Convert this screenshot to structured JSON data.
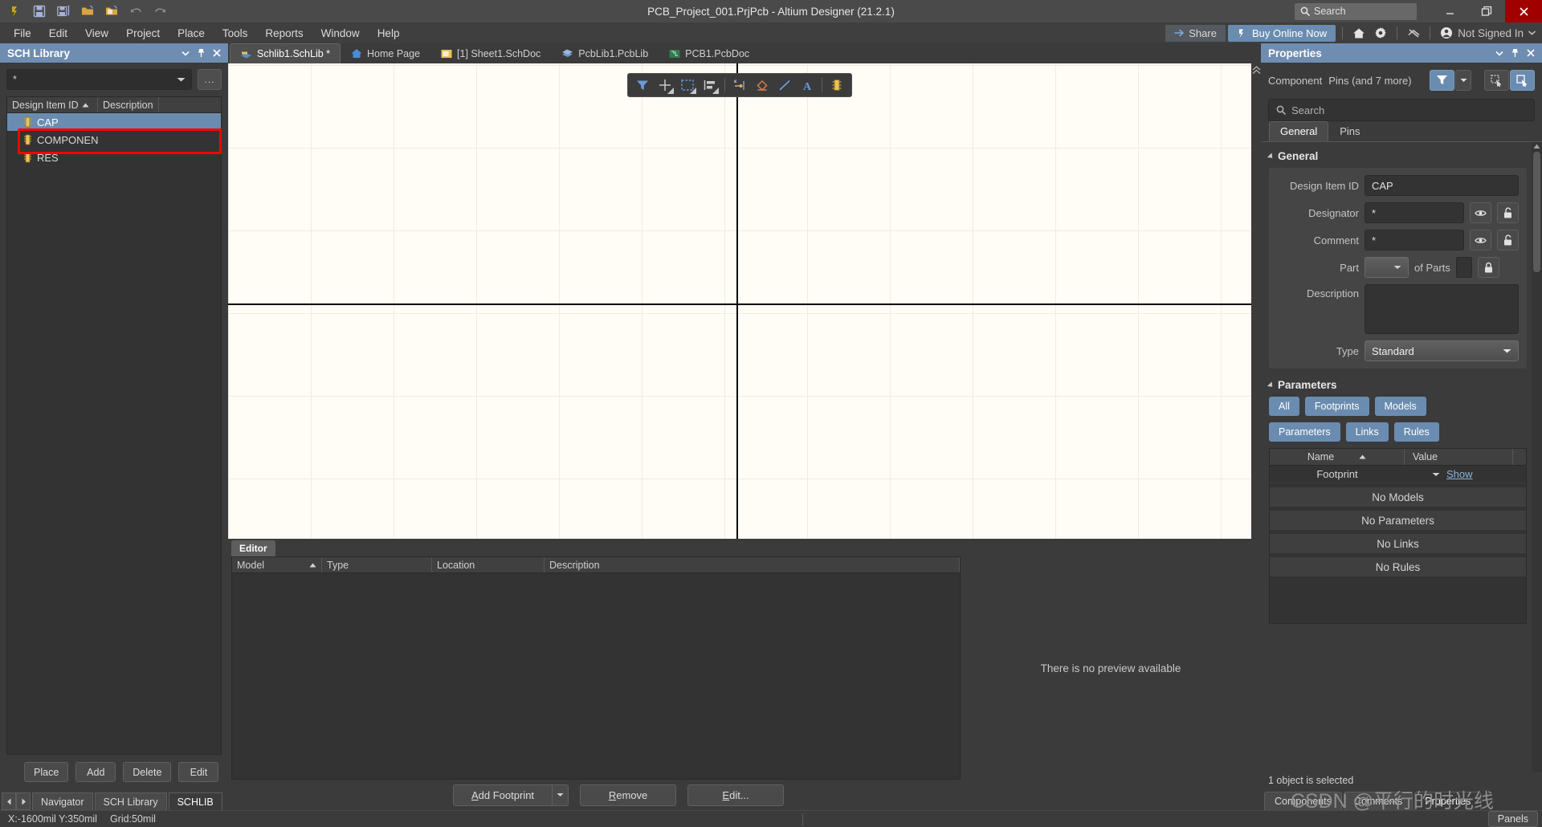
{
  "titlebar": {
    "title": "PCB_Project_001.PrjPcb - Altium Designer (21.2.1)",
    "search_placeholder": "Search",
    "quick_access": [
      {
        "name": "altium-logo-icon",
        "label": "Altium"
      },
      {
        "name": "save-icon",
        "label": "Save"
      },
      {
        "name": "save-all-icon",
        "label": "Save All"
      },
      {
        "name": "open-icon",
        "label": "Open"
      },
      {
        "name": "open-project-icon",
        "label": "Open Project"
      },
      {
        "name": "undo-icon",
        "label": "Undo"
      },
      {
        "name": "redo-icon",
        "label": "Redo"
      }
    ],
    "minimize": "–",
    "maximize": "❐",
    "close": "✕"
  },
  "menubar": {
    "items": [
      "File",
      "Edit",
      "View",
      "Project",
      "Place",
      "Tools",
      "Reports",
      "Window",
      "Help"
    ],
    "share_label": "Share",
    "buy_label": "Buy Online Now",
    "signin_label": "Not Signed In",
    "icons": [
      "home-icon",
      "settings-gear-icon",
      "notifications-icon"
    ]
  },
  "left_panel": {
    "title": "SCH Library",
    "filter_value": "*",
    "dots_label": "...",
    "columns": [
      {
        "label": "Design Item ID",
        "sorted": true
      },
      {
        "label": "Description",
        "sorted": false
      }
    ],
    "items": [
      {
        "label": "CAP",
        "selected": true
      },
      {
        "label": "COMPONEN",
        "selected": false
      },
      {
        "label": "RES",
        "selected": false
      }
    ],
    "buttons": [
      "Place",
      "Add",
      "Delete",
      "Edit"
    ],
    "tabs": [
      {
        "label": "Navigator",
        "active": false
      },
      {
        "label": "SCH Library",
        "active": false
      },
      {
        "label": "SCHLIB",
        "active": true
      }
    ]
  },
  "doc_tabs": [
    {
      "label": "Schlib1.SchLib *",
      "icon": "schlib-icon",
      "active": true
    },
    {
      "label": "Home Page",
      "icon": "home-icon",
      "active": false
    },
    {
      "label": "[1] Sheet1.SchDoc",
      "icon": "schdoc-icon",
      "active": false
    },
    {
      "label": "PcbLib1.PcbLib",
      "icon": "pcblib-icon",
      "active": false
    },
    {
      "label": "PCB1.PcbDoc",
      "icon": "pcbdoc-icon",
      "active": false
    }
  ],
  "float_toolbar": {
    "tools": [
      {
        "name": "filter-icon",
        "caret": false
      },
      {
        "name": "crosshair-icon",
        "caret": true
      },
      {
        "name": "selection-rect-icon",
        "caret": true
      },
      {
        "name": "align-icon",
        "caret": true
      },
      {
        "name": "place-pin-icon",
        "caret": false
      },
      {
        "name": "place-polygon-icon",
        "caret": false
      },
      {
        "name": "place-line-icon",
        "caret": false
      },
      {
        "name": "place-text-icon",
        "caret": false
      },
      {
        "name": "place-component-icon",
        "caret": false
      }
    ]
  },
  "model_panel": {
    "editor_tab": "Editor",
    "columns": [
      "Model",
      "Type",
      "Location",
      "Description"
    ],
    "preview_text": "There is no preview available",
    "buttons": {
      "add_footprint": "Add Footprint",
      "remove": "Remove",
      "edit": "Edit..."
    }
  },
  "properties": {
    "title": "Properties",
    "object_type": "Component",
    "object_detail": "Pins (and 7 more)",
    "search_placeholder": "Search",
    "tabs": [
      {
        "label": "General",
        "active": true
      },
      {
        "label": "Pins",
        "active": false
      }
    ],
    "general": {
      "section_title": "General",
      "design_item_id_label": "Design Item ID",
      "design_item_id_value": "CAP",
      "designator_label": "Designator",
      "designator_value": "*",
      "comment_label": "Comment",
      "comment_value": "*",
      "part_label": "Part",
      "part_value": "",
      "of_parts_label": "of Parts",
      "description_label": "Description",
      "description_value": "",
      "type_label": "Type",
      "type_value": "Standard"
    },
    "parameters": {
      "section_title": "Parameters",
      "filters": [
        {
          "label": "All",
          "row": 1
        },
        {
          "label": "Footprints",
          "row": 1
        },
        {
          "label": "Models",
          "row": 1
        },
        {
          "label": "Parameters",
          "row": 2
        },
        {
          "label": "Links",
          "row": 2
        },
        {
          "label": "Rules",
          "row": 2
        }
      ],
      "columns": [
        "Name",
        "Value"
      ],
      "rows": [
        {
          "name": "Footprint",
          "value": "Show"
        }
      ],
      "empty_states": [
        "No Models",
        "No Parameters",
        "No Links",
        "No Rules"
      ]
    },
    "status": "1 object is selected",
    "bottom_tabs": [
      {
        "label": "Components",
        "active": false
      },
      {
        "label": "Comments",
        "active": false
      },
      {
        "label": "Properties",
        "active": true
      }
    ]
  },
  "statusbar": {
    "coordinates": "X:-1600mil Y:350mil",
    "grid": "Grid:50mil",
    "panels_label": "Panels"
  },
  "watermark": "CSDN @平行的时光线",
  "colors": {
    "accent": "#6a8cb0",
    "panel_bg": "#3b3b3b",
    "canvas_bg": "#fffdf5",
    "annotation_red": "#fe0000",
    "close_red": "#a00000"
  }
}
